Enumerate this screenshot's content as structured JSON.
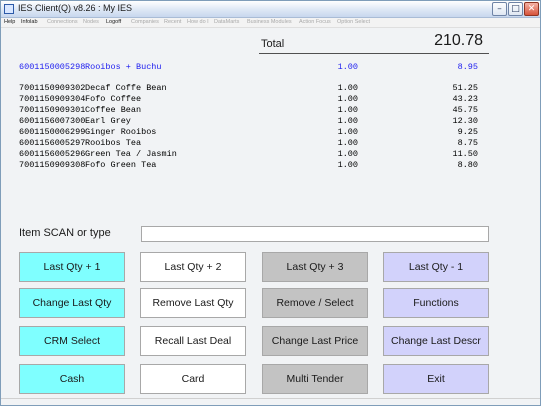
{
  "window": {
    "title": "IES Client(Q) v8.26 : My IES"
  },
  "menu": [
    {
      "label": "Help",
      "enabled": true
    },
    {
      "label": "Infolab",
      "enabled": true
    },
    {
      "label": "Connections",
      "enabled": false
    },
    {
      "label": "Nodes",
      "enabled": false
    },
    {
      "label": "Logoff",
      "enabled": true
    },
    {
      "label": "Companies",
      "enabled": false
    },
    {
      "label": "Recent",
      "enabled": false
    },
    {
      "label": "How do I",
      "enabled": false
    },
    {
      "label": "DataMarts",
      "enabled": false
    },
    {
      "label": "Business Modules",
      "enabled": false
    },
    {
      "label": "Action Focus",
      "enabled": false
    },
    {
      "label": "Option Select",
      "enabled": false
    }
  ],
  "total": {
    "label": "Total",
    "value": "210.78"
  },
  "current_item": {
    "code": "6001150005298",
    "description": "Rooibos + Buchu",
    "qty": "1.00",
    "price": "8.95",
    "color": "#1d1df0"
  },
  "items": [
    {
      "code": "7001150909302",
      "description": "Decaf Coffe Bean",
      "qty": "1.00",
      "price": "51.25"
    },
    {
      "code": "7001150909304",
      "description": "Fofo Coffee",
      "qty": "1.00",
      "price": "43.23"
    },
    {
      "code": "7001150909301",
      "description": "Coffee Bean",
      "qty": "1.00",
      "price": "45.75"
    },
    {
      "code": "6001156007300",
      "description": "Earl Grey",
      "qty": "1.00",
      "price": "12.30"
    },
    {
      "code": "6001150006299",
      "description": "Ginger Rooibos",
      "qty": "1.00",
      "price": "9.25"
    },
    {
      "code": "6001156005297",
      "description": "Rooibos Tea",
      "qty": "1.00",
      "price": "8.75"
    },
    {
      "code": "6001156005296",
      "description": "Green Tea / Jasmin",
      "qty": "1.00",
      "price": "11.50"
    },
    {
      "code": "7001150909308",
      "description": "Fofo Green Tea",
      "qty": "1.00",
      "price": "8.80"
    }
  ],
  "scan": {
    "label": "Item SCAN or type",
    "value": ""
  },
  "colors": {
    "cyan": "#7fffff",
    "white": "#ffffff",
    "gray": "#c3c3c3",
    "lavender": "#d2d2fb"
  },
  "buttons": {
    "last_qty_plus_1": "Last Qty + 1",
    "last_qty_plus_2": "Last Qty + 2",
    "last_qty_plus_3": "Last Qty + 3",
    "last_qty_minus_1": "Last Qty - 1",
    "change_last_qty": "Change Last Qty",
    "remove_last_qty": "Remove Last Qty",
    "remove_select": "Remove / Select",
    "functions": "Functions",
    "crm_select": "CRM Select",
    "recall_last_deal": "Recall Last Deal",
    "change_last_price": "Change Last Price",
    "change_last_descr": "Change Last Descr",
    "cash": "Cash",
    "card": "Card",
    "multi_tender": "Multi Tender",
    "exit": "Exit"
  }
}
